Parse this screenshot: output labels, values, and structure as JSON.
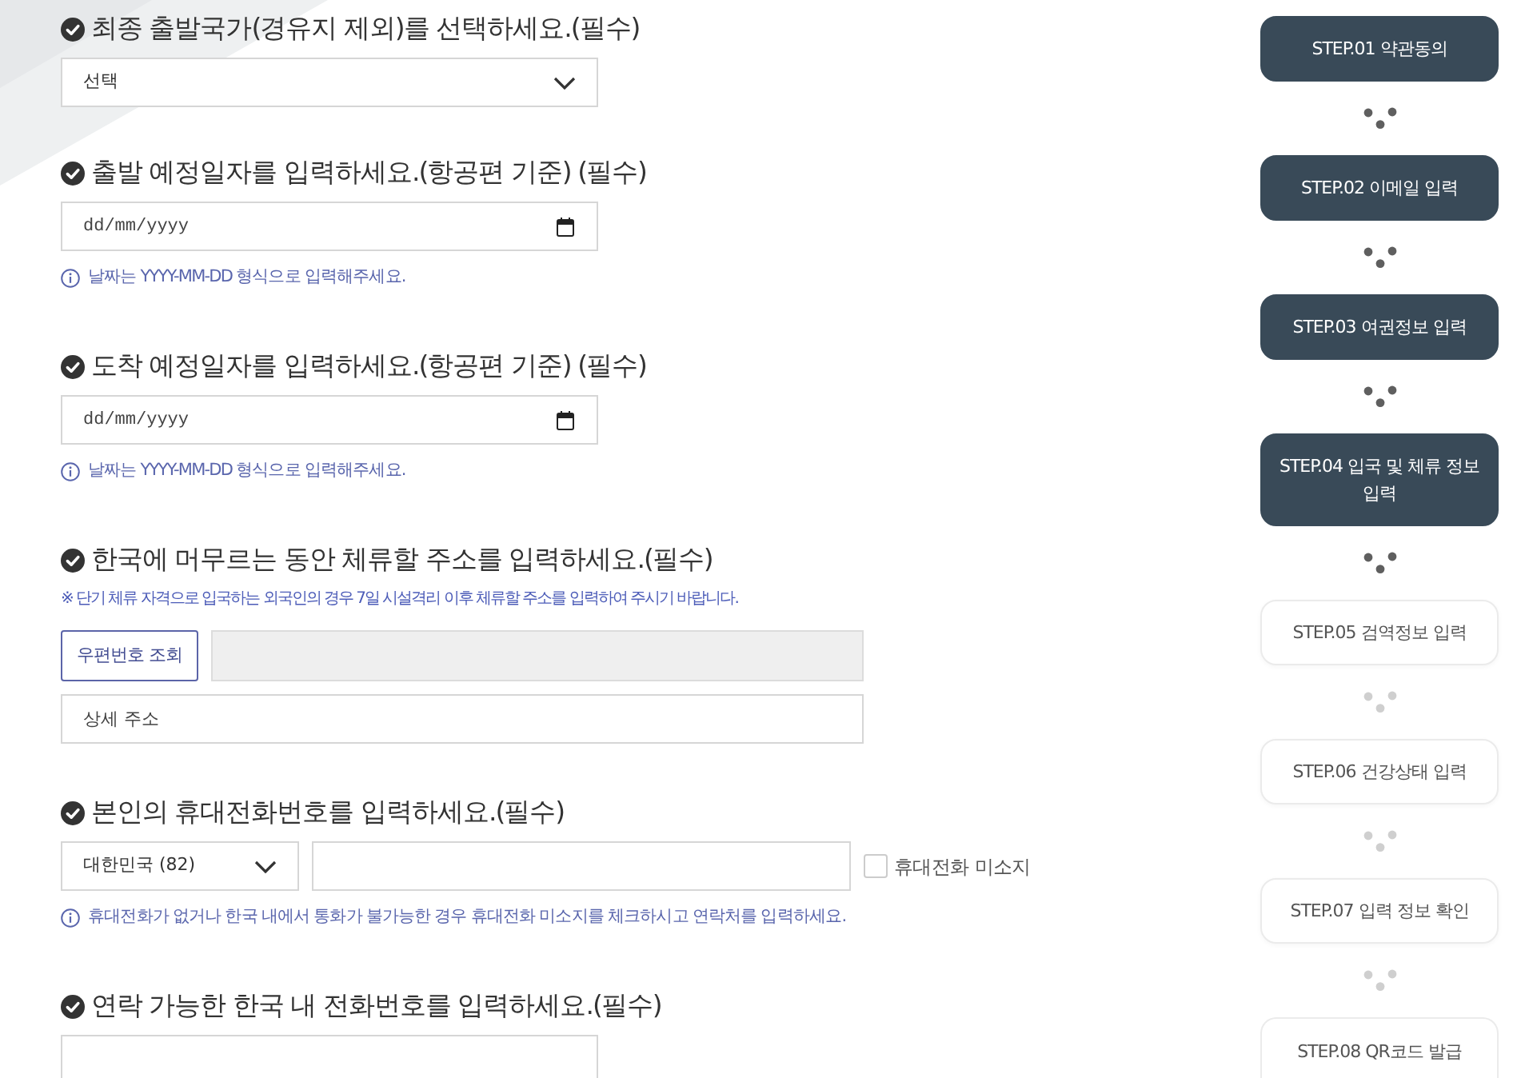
{
  "sections": [
    {
      "kind": "select",
      "title": "최종 출발국가(경유지 제외)를 선택하세요.(필수)",
      "select": {
        "value": "선택"
      }
    },
    {
      "kind": "date",
      "title": "출발 예정일자를 입력하세요.(항공편 기준) (필수)",
      "date_field": {
        "placeholder": "dd/mm/yyyy"
      },
      "hint": "날짜는 YYYY-MM-DD 형식으로 입력해주세요."
    },
    {
      "kind": "date",
      "title": "도착 예정일자를 입력하세요.(항공편 기준) (필수)",
      "date_field": {
        "placeholder": "dd/mm/yyyy"
      },
      "hint": "날짜는 YYYY-MM-DD 형식으로 입력해주세요."
    },
    {
      "kind": "address",
      "title": "한국에 머무르는 동안 체류할 주소를 입력하세요.(필수)",
      "note": "※ 단기 체류 자격으로 입국하는 외국인의 경우 7일 시설격리 이후 체류할 주소를 입력하여 주시기 바랍니다.",
      "postal_search_button": "우편번호 조회",
      "detail_address": {
        "placeholder": "상세 주소"
      }
    },
    {
      "kind": "phone",
      "title": "본인의 휴대전화번호를 입력하세요.(필수)",
      "country_code": {
        "value": "대한민국 (82)"
      },
      "no_phone": {
        "label": "휴대전화 미소지",
        "checked": false
      },
      "hint": "휴대전화가 없거나 한국 내에서 통화가 불가능한 경우 휴대전화 미소지를 체크하시고 연락처를 입력하세요."
    },
    {
      "kind": "text",
      "title": "연락 가능한 한국 내 전화번호를 입력하세요.(필수)"
    }
  ],
  "steps": [
    {
      "label": "STEP.01 약관동의",
      "active": true
    },
    {
      "label": "STEP.02 이메일 입력",
      "active": true
    },
    {
      "label": "STEP.03 여권정보 입력",
      "active": true
    },
    {
      "label": "STEP.04 입국 및 체류 정보 입력",
      "active": true
    },
    {
      "label": "STEP.05 검역정보 입력",
      "active": false
    },
    {
      "label": "STEP.06 건강상태 입력",
      "active": false
    },
    {
      "label": "STEP.07 입력 정보 확인",
      "active": false
    },
    {
      "label": "STEP.08 QR코드 발급",
      "active": false
    }
  ]
}
